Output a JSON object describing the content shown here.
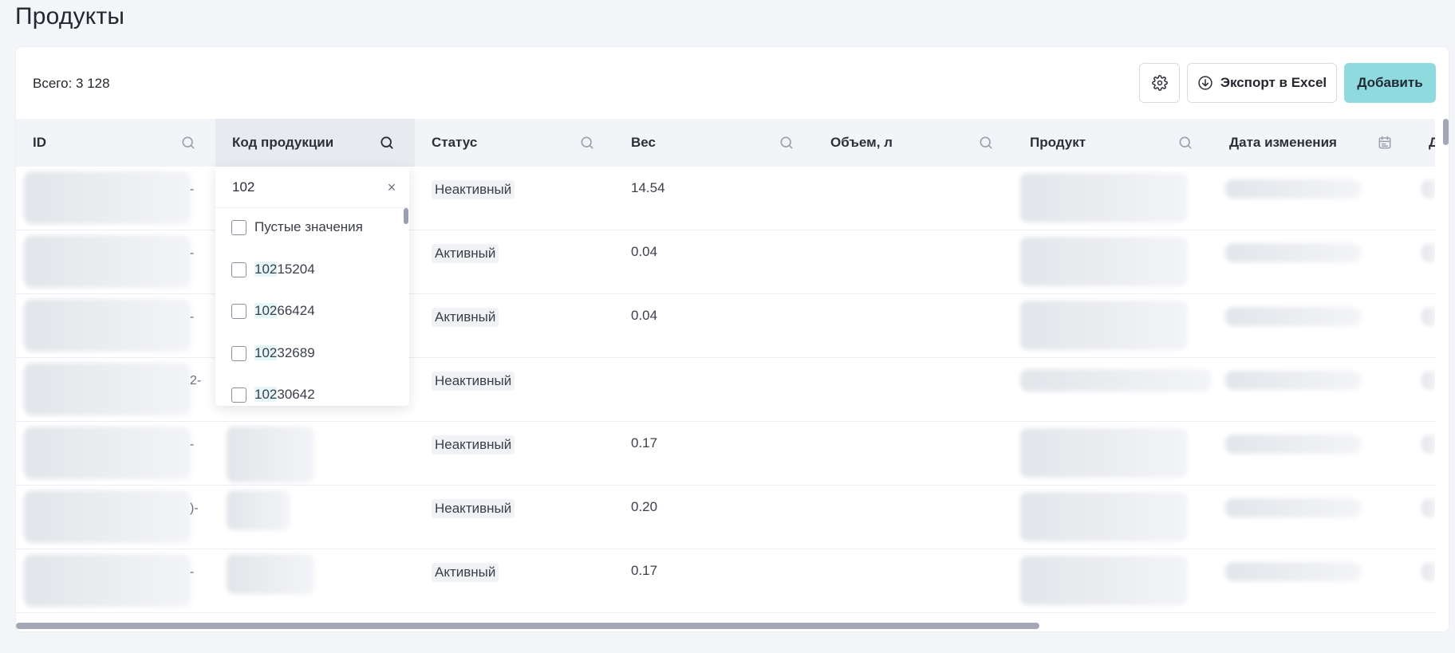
{
  "page": {
    "title": "Продукты"
  },
  "toolbar": {
    "total_label": "Всего: 3 128",
    "export_label": "Экспорт в Excel",
    "add_label": "Добавить"
  },
  "columns": [
    {
      "label": "ID",
      "icon": "search-icon"
    },
    {
      "label": "Код продукции",
      "icon": "search-icon",
      "active": true
    },
    {
      "label": "Статус",
      "icon": "search-icon"
    },
    {
      "label": "Вес",
      "icon": "search-icon"
    },
    {
      "label": "Объем, л",
      "icon": "search-icon"
    },
    {
      "label": "Продукт",
      "icon": "search-icon"
    },
    {
      "label": "Дата изменения",
      "icon": "calendar-icon"
    },
    {
      "label": "Да"
    }
  ],
  "rows": [
    {
      "status": "Неактивный",
      "weight": "14.54"
    },
    {
      "status": "Активный",
      "weight": "0.04"
    },
    {
      "status": "Активный",
      "weight": "0.04"
    },
    {
      "status": "Неактивный",
      "weight": ""
    },
    {
      "status": "Неактивный",
      "weight": "0.17"
    },
    {
      "status": "Неактивный",
      "weight": "0.20"
    },
    {
      "status": "Активный",
      "weight": "0.17"
    }
  ],
  "filter": {
    "value": "102",
    "options": [
      {
        "match": "",
        "rest": "Пустые значения"
      },
      {
        "match": "102",
        "rest": "15204"
      },
      {
        "match": "102",
        "rest": "66424"
      },
      {
        "match": "102",
        "rest": "32689"
      },
      {
        "match": "102",
        "rest": "30642"
      }
    ]
  },
  "colors": {
    "accent": "#8fdadf",
    "highlight": "#e4f6f7",
    "header_bg": "#f3f4f8"
  }
}
